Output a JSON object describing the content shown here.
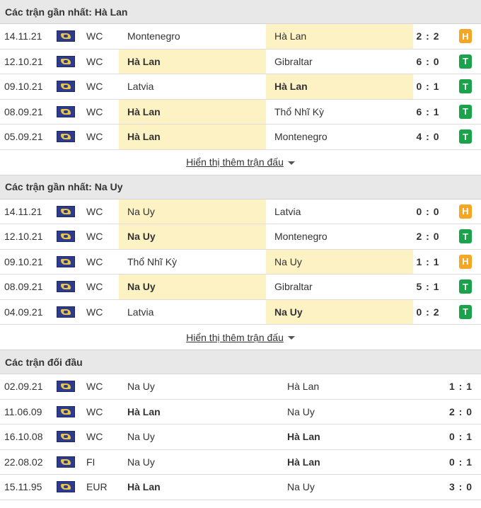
{
  "sections": [
    {
      "title": "Các trận gần nhất: Hà Lan",
      "more_label": "Hiển thị thêm trận đấu",
      "rows": [
        {
          "date": "14.11.21",
          "comp": "WC",
          "home": "Montenegro",
          "away": "Hà Lan",
          "score": "2 : 2",
          "result": "H",
          "focus": "away"
        },
        {
          "date": "12.10.21",
          "comp": "WC",
          "home": "Hà Lan",
          "away": "Gibraltar",
          "score": "6 : 0",
          "result": "T",
          "focus": "home"
        },
        {
          "date": "09.10.21",
          "comp": "WC",
          "home": "Latvia",
          "away": "Hà Lan",
          "score": "0 : 1",
          "result": "T",
          "focus": "away"
        },
        {
          "date": "08.09.21",
          "comp": "WC",
          "home": "Hà Lan",
          "away": "Thổ Nhĩ Kỳ",
          "score": "6 : 1",
          "result": "T",
          "focus": "home"
        },
        {
          "date": "05.09.21",
          "comp": "WC",
          "home": "Hà Lan",
          "away": "Montenegro",
          "score": "4 : 0",
          "result": "T",
          "focus": "home"
        }
      ]
    },
    {
      "title": "Các trận gần nhất: Na Uy",
      "more_label": "Hiển thị thêm trận đấu",
      "rows": [
        {
          "date": "14.11.21",
          "comp": "WC",
          "home": "Na Uy",
          "away": "Latvia",
          "score": "0 : 0",
          "result": "H",
          "focus": "home"
        },
        {
          "date": "12.10.21",
          "comp": "WC",
          "home": "Na Uy",
          "away": "Montenegro",
          "score": "2 : 0",
          "result": "T",
          "focus": "home"
        },
        {
          "date": "09.10.21",
          "comp": "WC",
          "home": "Thổ Nhĩ Kỳ",
          "away": "Na Uy",
          "score": "1 : 1",
          "result": "H",
          "focus": "away"
        },
        {
          "date": "08.09.21",
          "comp": "WC",
          "home": "Na Uy",
          "away": "Gibraltar",
          "score": "5 : 1",
          "result": "T",
          "focus": "home"
        },
        {
          "date": "04.09.21",
          "comp": "WC",
          "home": "Latvia",
          "away": "Na Uy",
          "score": "0 : 2",
          "result": "T",
          "focus": "away"
        }
      ]
    }
  ],
  "h2h": {
    "title": "Các trận đối đầu",
    "rows": [
      {
        "date": "02.09.21",
        "comp": "WC",
        "home": "Na Uy",
        "away": "Hà Lan",
        "score": "1 : 1",
        "winner": ""
      },
      {
        "date": "11.06.09",
        "comp": "WC",
        "home": "Hà Lan",
        "away": "Na Uy",
        "score": "2 : 0",
        "winner": "home"
      },
      {
        "date": "16.10.08",
        "comp": "WC",
        "home": "Na Uy",
        "away": "Hà Lan",
        "score": "0 : 1",
        "winner": "away"
      },
      {
        "date": "22.08.02",
        "comp": "FI",
        "home": "Na Uy",
        "away": "Hà Lan",
        "score": "0 : 1",
        "winner": "away"
      },
      {
        "date": "15.11.95",
        "comp": "EUR",
        "home": "Hà Lan",
        "away": "Na Uy",
        "score": "3 : 0",
        "winner": "home"
      }
    ]
  },
  "colors": {
    "highlight": "#fdf2c4",
    "draw_badge": "#f5a623",
    "win_badge": "#1aa34a",
    "header_bg": "#e8e8e8"
  }
}
